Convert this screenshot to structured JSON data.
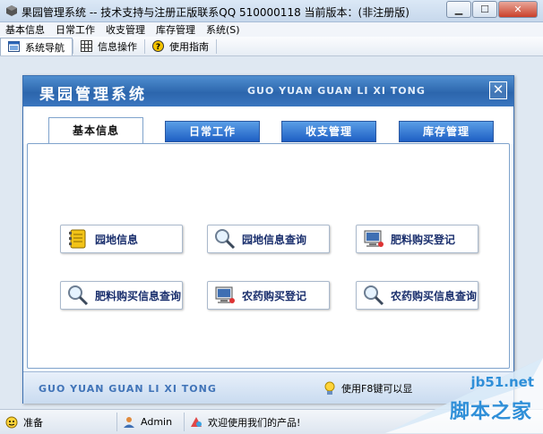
{
  "window": {
    "title": "果园管理系统 -- 技术支持与注册正版联系QQ 510000118    当前版本：(非注册版)"
  },
  "menu": {
    "items": [
      "基本信息",
      "日常工作",
      "收支管理",
      "库存管理",
      "系统(S)"
    ]
  },
  "toolbar": {
    "buttons": [
      {
        "label": "系统导航",
        "icon": "window-icon"
      },
      {
        "label": "信息操作",
        "icon": "grid-icon"
      },
      {
        "label": "使用指南",
        "icon": "help-icon"
      }
    ]
  },
  "panel": {
    "title": "果园管理系统",
    "pinyin": "GUO YUAN GUAN LI XI TONG",
    "close": "✕"
  },
  "tabs": [
    {
      "label": "基本信息",
      "active": true
    },
    {
      "label": "日常工作",
      "active": false
    },
    {
      "label": "收支管理",
      "active": false
    },
    {
      "label": "库存管理",
      "active": false
    }
  ],
  "actions": [
    {
      "label": "园地信息",
      "icon": "notebook-icon"
    },
    {
      "label": "园地信息查询",
      "icon": "magnifier-icon"
    },
    {
      "label": "肥料购买登记",
      "icon": "computer-icon"
    },
    {
      "label": "肥料购买信息查询",
      "icon": "magnifier-icon"
    },
    {
      "label": "农药购买登记",
      "icon": "computer-icon"
    },
    {
      "label": "农药购买信息查询",
      "icon": "magnifier-icon"
    }
  ],
  "footer": {
    "pinyin": "GUO YUAN GUAN LI XI TONG",
    "hint": "使用F8键可以显"
  },
  "status": {
    "ready": "准备",
    "user": "Admin",
    "welcome": "欢迎使用我们的产品!"
  },
  "watermark": {
    "site": "jb51.net",
    "name": "脚本之家"
  },
  "colors": {
    "header_blue": "#2c66ad",
    "tab_blue": "#1e5fc4",
    "label_navy": "#1a2f6d",
    "watermark_blue": "#2f8fd8"
  }
}
